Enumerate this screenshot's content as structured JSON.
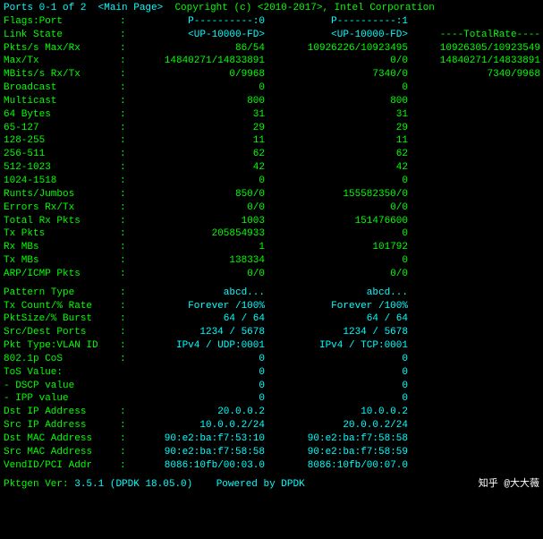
{
  "header": {
    "ports_label": "Ports 0-1 of 2",
    "main_page": "<Main Page>",
    "copyright": "Copyright (c) <2010-2017>, Intel Corporation"
  },
  "flags_row": {
    "label": "  Flags:Port",
    "colon": ":",
    "p0_header": "P----------:0",
    "p1_header": "P----------:1"
  },
  "link_state": {
    "label": "Link State",
    "colon": ":",
    "val0": "<UP-10000-FD>",
    "val1": "<UP-10000-FD>",
    "total": "----TotalRate----"
  },
  "pkts_max_rx": {
    "label": "Pkts/s Max/Rx",
    "colon": ":",
    "val0": "86/54",
    "val1": "10926226/10923495",
    "total": "10926305/10923549"
  },
  "max_tx": {
    "label": "       Max/Tx",
    "colon": ":",
    "val0": "14840271/14833891",
    "val1": "0/0",
    "total": "14840271/14833891"
  },
  "mbits_rx_tx": {
    "label": "MBits/s Rx/Tx",
    "colon": ":",
    "val0": "0/9968",
    "val1": "7340/0",
    "total": "7340/9968"
  },
  "broadcast": {
    "label": "Broadcast",
    "colon": ":",
    "val0": "0",
    "val1": "0",
    "total": ""
  },
  "multicast": {
    "label": "Multicast",
    "colon": ":",
    "val0": "800",
    "val1": "800",
    "total": ""
  },
  "bytes_64": {
    "label": "  64 Bytes",
    "colon": ":",
    "val0": "31",
    "val1": "31",
    "total": ""
  },
  "bytes_65_127": {
    "label": "  65-127",
    "colon": ":",
    "val0": "29",
    "val1": "29",
    "total": ""
  },
  "bytes_128_255": {
    "label": "  128-255",
    "colon": ":",
    "val0": "11",
    "val1": "11",
    "total": ""
  },
  "bytes_256_511": {
    "label": "  256-511",
    "colon": ":",
    "val0": "62",
    "val1": "62",
    "total": ""
  },
  "bytes_512_1023": {
    "label": "  512-1023",
    "colon": ":",
    "val0": "42",
    "val1": "42",
    "total": ""
  },
  "bytes_1024_1518": {
    "label": "  1024-1518",
    "colon": ":",
    "val0": "0",
    "val1": "0",
    "total": ""
  },
  "runts_jumbos": {
    "label": "Runts/Jumbos",
    "colon": ":",
    "val0": "850/0",
    "val1": "155582350/0",
    "total": ""
  },
  "errors_rx_tx": {
    "label": "Errors Rx/Tx",
    "colon": ":",
    "val0": "0/0",
    "val1": "0/0",
    "total": ""
  },
  "total_rx_pkts": {
    "label": "Total Rx Pkts",
    "colon": ":",
    "val0": "1003",
    "val1": "151476600",
    "total": ""
  },
  "tx_pkts": {
    "label": "     Tx Pkts",
    "colon": ":",
    "val0": "205854933",
    "val1": "0",
    "total": ""
  },
  "rx_mbs": {
    "label": "     Rx MBs",
    "colon": ":",
    "val0": "1",
    "val1": "101792",
    "total": ""
  },
  "tx_mbs": {
    "label": "     Tx MBs",
    "colon": ":",
    "val0": "138334",
    "val1": "0",
    "total": ""
  },
  "arp_icmp": {
    "label": "ARP/ICMP Pkts",
    "colon": ":",
    "val0": "0/0",
    "val1": "0/0",
    "total": ""
  },
  "pattern_type": {
    "label": "Pattern Type",
    "colon": ":",
    "val0": "abcd...",
    "val1": "abcd...",
    "total": ""
  },
  "tx_count_rate": {
    "label": "Tx Count/% Rate",
    "colon": ":",
    "val0": "Forever /100%",
    "val1": "Forever /100%",
    "total": ""
  },
  "pkt_size_burst": {
    "label": "PktSize/% Burst",
    "colon": ":",
    "val0": "64 /  64",
    "val1": "64 /  64",
    "total": ""
  },
  "src_dest_port": {
    "label": "Src/Dest Ports",
    "colon": ":",
    "val0": "1234 / 5678",
    "val1": "1234 / 5678",
    "total": ""
  },
  "pkt_type_vlan": {
    "label": "Pkt Type:VLAN ID",
    "colon": ":",
    "val0": "IPv4 / UDP:0001",
    "val1": "IPv4 / TCP:0001",
    "total": ""
  },
  "cos_802": {
    "label": "802.1p CoS",
    "colon": ":",
    "val0": "0",
    "val1": "0",
    "total": ""
  },
  "tos_value": {
    "label": "ToS Value:",
    "colon": "",
    "val0": "0",
    "val1": "0",
    "total": ""
  },
  "dscp_value": {
    "label": " - DSCP value",
    "colon": "",
    "val0": "0",
    "val1": "0",
    "total": ""
  },
  "ipp_value": {
    "label": " - IPP  value",
    "colon": "",
    "val0": "0",
    "val1": "0",
    "total": ""
  },
  "dst_ip": {
    "label": "Dst  IP Address",
    "colon": ":",
    "val0": "20.0.0.2",
    "val1": "10.0.0.2",
    "total": ""
  },
  "src_ip": {
    "label": "Src  IP Address",
    "colon": ":",
    "val0": "10.0.0.2/24",
    "val1": "20.0.0.2/24",
    "total": ""
  },
  "dst_mac": {
    "label": "Dst MAC Address",
    "colon": ":",
    "val0": "90:e2:ba:f7:53:10",
    "val1": "90:e2:ba:f7:58:58",
    "total": ""
  },
  "src_mac": {
    "label": "Src MAC Address",
    "colon": ":",
    "val0": "90:e2:ba:f7:58:58",
    "val1": "90:e2:ba:f7:58:59",
    "total": ""
  },
  "vendid_pci": {
    "label": "VendID/PCI Addr",
    "colon": ":",
    "val0": "8086:10fb/00:03.0",
    "val1": "8086:10fb/00:07.0",
    "total": ""
  },
  "footer": {
    "pktgen_label": "Pktgen Ver:",
    "pktgen_version": "3.5.1 (DPDK 18.05.0)",
    "powered_by": "Powered by DPDK",
    "credit": "知乎 @大大薇"
  }
}
